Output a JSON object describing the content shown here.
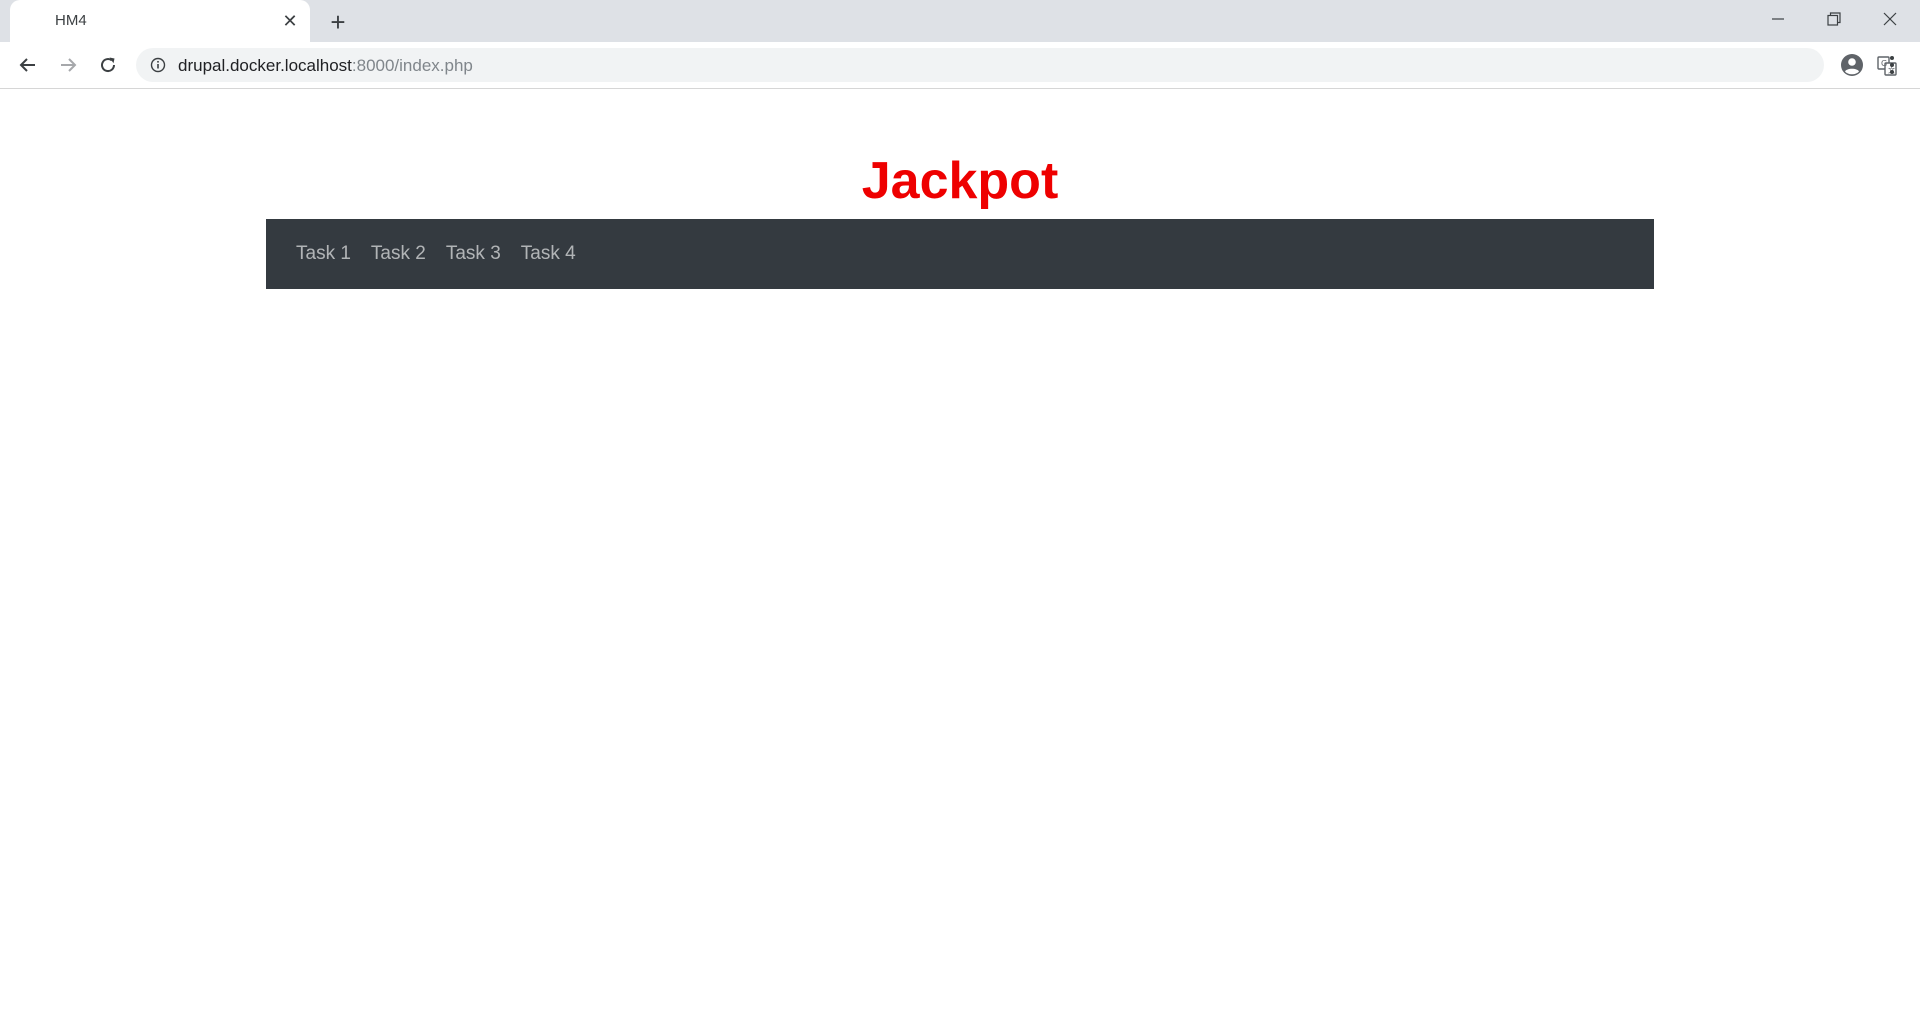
{
  "browser": {
    "tab_title": "HM4",
    "tab_close": "✕",
    "new_tab": "+",
    "url_host": "drupal.docker.localhost",
    "url_path": ":8000/index.php"
  },
  "page": {
    "title": "Jackpot",
    "title_color": "#ee0000",
    "navbar_color": "#343a40",
    "nav_items": [
      {
        "label": "Task 1"
      },
      {
        "label": "Task 2"
      },
      {
        "label": "Task 3"
      },
      {
        "label": "Task 4"
      }
    ]
  }
}
